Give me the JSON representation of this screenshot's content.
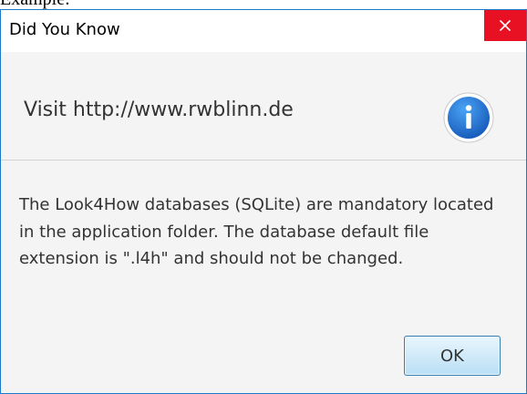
{
  "window": {
    "title": "Did You Know",
    "background_caption": "Example:"
  },
  "header": {
    "text": "Visit http://www.rwblinn.de",
    "icon": "info-icon"
  },
  "message": {
    "text": "The Look4How databases (SQLite) are mandatory located in the application folder. The database default file extension is \".l4h\" and should not be changed."
  },
  "buttons": {
    "ok_label": "OK",
    "close_icon": "close-icon"
  },
  "colors": {
    "close_button": "#e81123",
    "info_icon": "#1d6fd0",
    "window_border": "#1979ca",
    "content_background": "#f4f4f4"
  }
}
